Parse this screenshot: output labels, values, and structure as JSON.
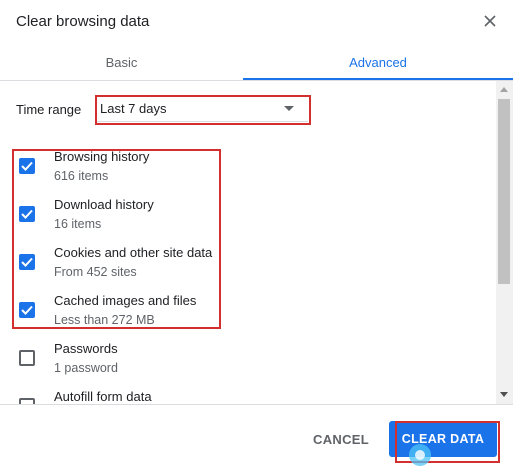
{
  "dialog": {
    "title": "Clear browsing data",
    "close_icon": "close-icon"
  },
  "tabs": [
    {
      "label": "Basic",
      "active": false
    },
    {
      "label": "Advanced",
      "active": true
    }
  ],
  "time_range": {
    "label": "Time range",
    "value": "Last 7 days",
    "icon": "dropdown-arrow-icon"
  },
  "items": [
    {
      "label": "Browsing history",
      "sub": "616 items",
      "checked": true
    },
    {
      "label": "Download history",
      "sub": "16 items",
      "checked": true
    },
    {
      "label": "Cookies and other site data",
      "sub": "From 452 sites",
      "checked": true
    },
    {
      "label": "Cached images and files",
      "sub": "Less than 272 MB",
      "checked": true
    },
    {
      "label": "Passwords",
      "sub": "1 password",
      "checked": false
    },
    {
      "label": "Autofill form data",
      "sub": "",
      "checked": false
    }
  ],
  "footer": {
    "cancel_label": "CANCEL",
    "clear_label": "CLEAR DATA"
  },
  "colors": {
    "accent": "#1a73e8",
    "highlight": "#d32f2f",
    "text": "#202124",
    "subtext": "#5f6368"
  }
}
